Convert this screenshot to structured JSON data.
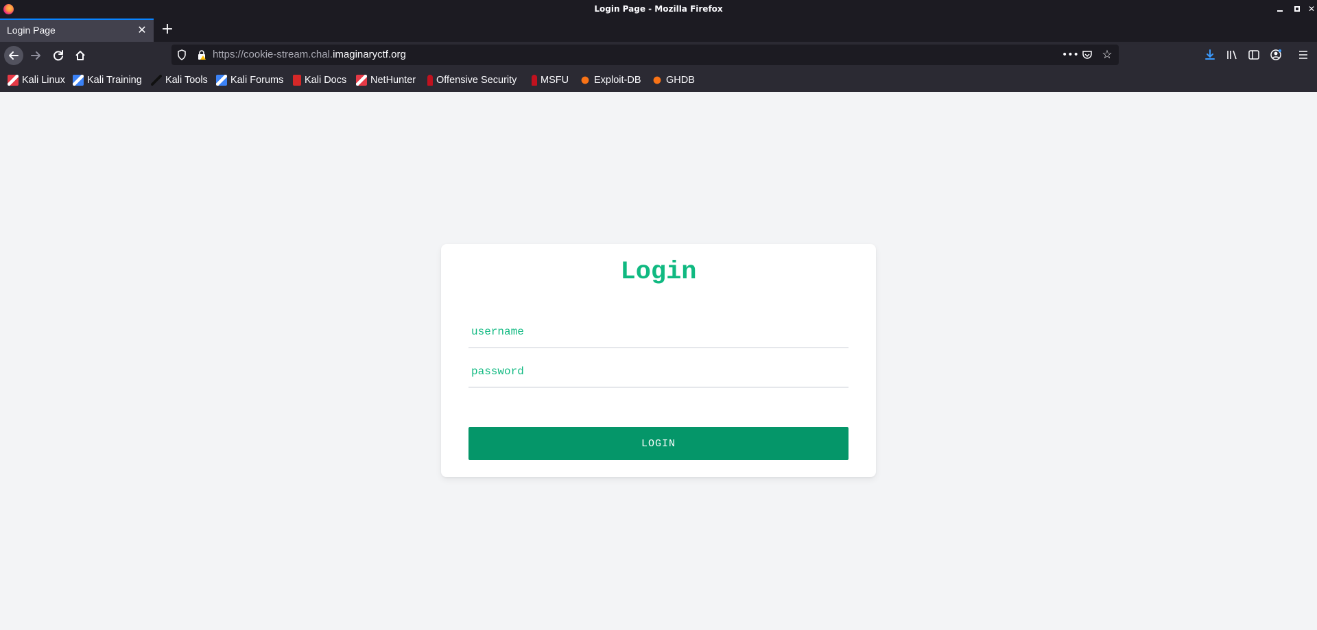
{
  "window": {
    "title": "Login Page - Mozilla Firefox"
  },
  "tabs": [
    {
      "label": "Login Page",
      "active": true
    }
  ],
  "navbar": {
    "url_prefix": "https://cookie-stream.chal.",
    "url_domain": "imaginaryctf.org"
  },
  "bookmarks": [
    {
      "label": "Kali Linux",
      "icon": "kali-linux-icon",
      "color": "#e63946"
    },
    {
      "label": "Kali Training",
      "icon": "kali-training-icon",
      "color": "#3b82f6"
    },
    {
      "label": "Kali Tools",
      "icon": "kali-tools-icon",
      "color": "#222222"
    },
    {
      "label": "Kali Forums",
      "icon": "kali-forums-icon",
      "color": "#3b82f6"
    },
    {
      "label": "Kali Docs",
      "icon": "kali-docs-icon",
      "color": "#d62828"
    },
    {
      "label": "NetHunter",
      "icon": "nethunter-icon",
      "color": "#e63946"
    },
    {
      "label": "Offensive Security",
      "icon": "offsec-icon",
      "color": "#c1121f"
    },
    {
      "label": "MSFU",
      "icon": "msfu-icon",
      "color": "#c1121f"
    },
    {
      "label": "Exploit-DB",
      "icon": "exploit-db-icon",
      "color": "#f97316"
    },
    {
      "label": "GHDB",
      "icon": "ghdb-icon",
      "color": "#f97316"
    }
  ],
  "login": {
    "heading": "Login",
    "username_placeholder": "username",
    "password_placeholder": "password",
    "button_label": "LOGIN"
  },
  "colors": {
    "accent": "#10b981",
    "button": "#059669",
    "page_bg": "#f3f4f6",
    "chrome_dark": "#1c1b22",
    "chrome": "#2b2a33",
    "tab_highlight": "#0a84ff"
  }
}
